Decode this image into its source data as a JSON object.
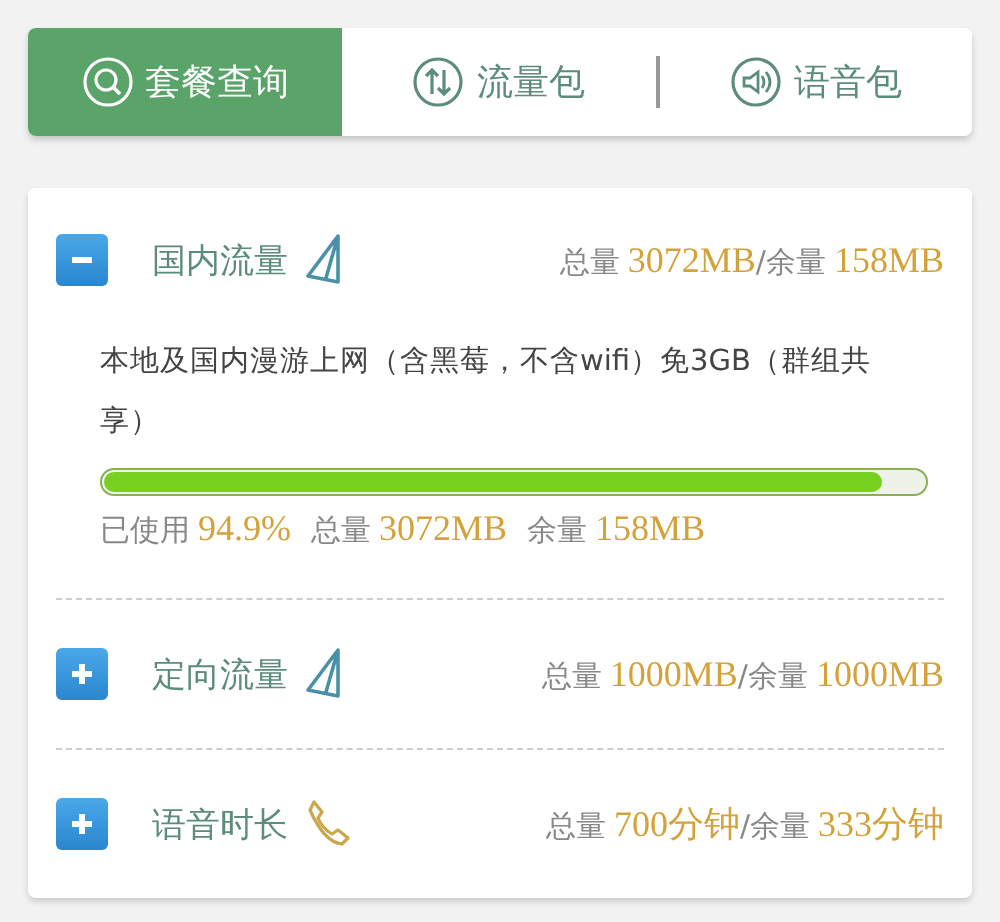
{
  "tabs": [
    {
      "label": "套餐查询",
      "kind": "query",
      "selected": true
    },
    {
      "label": "流量包",
      "kind": "data",
      "selected": false
    },
    {
      "label": "语音包",
      "kind": "voice",
      "selected": false
    }
  ],
  "sections": [
    {
      "title": "国内流量",
      "kind": "data",
      "expanded": true,
      "summary": [
        {
          "kind": "label",
          "text": "总量"
        },
        {
          "kind": "value",
          "text": "3072MB"
        },
        {
          "kind": "label",
          "text": "/余量"
        },
        {
          "kind": "value",
          "text": "158MB"
        }
      ],
      "description": "本地及国内漫游上网（含黑莓，不含wifi）免3GB（群组共享）",
      "level": 0.949,
      "usage": [
        {
          "kind": "label",
          "text": "已使用"
        },
        {
          "kind": "value",
          "text": "94.9%"
        },
        {
          "kind": "label",
          "text": "总量"
        },
        {
          "kind": "value",
          "text": "3072MB"
        },
        {
          "kind": "label",
          "text": "余量"
        },
        {
          "kind": "value",
          "text": "158MB"
        }
      ]
    },
    {
      "title": "定向流量",
      "kind": "data",
      "expanded": false,
      "summary": [
        {
          "kind": "label",
          "text": "总量"
        },
        {
          "kind": "value",
          "text": "1000MB"
        },
        {
          "kind": "label",
          "text": "/余量"
        },
        {
          "kind": "value",
          "text": "1000MB"
        }
      ]
    },
    {
      "title": "语音时长",
      "kind": "voice",
      "expanded": false,
      "summary": [
        {
          "kind": "label",
          "text": "总量"
        },
        {
          "kind": "value",
          "text": "700分钟"
        },
        {
          "kind": "label",
          "text": "/余量"
        },
        {
          "kind": "value",
          "text": "333分钟"
        }
      ]
    }
  ]
}
